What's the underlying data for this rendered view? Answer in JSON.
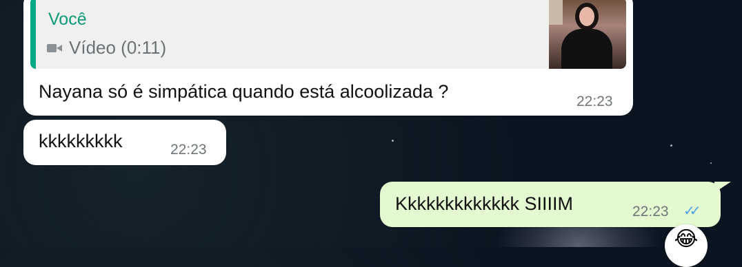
{
  "messages": [
    {
      "direction": "incoming",
      "reply_to": {
        "author": "Você",
        "media_label": "Vídeo (0:11)",
        "media_icon": "video-icon",
        "has_thumbnail": true
      },
      "text": "Nayana só é simpática quando está alcoolizada ?",
      "time": "22:23"
    },
    {
      "direction": "incoming",
      "text": "kkkkkkkkk",
      "time": "22:23"
    },
    {
      "direction": "outgoing",
      "text": "Kkkkkkkkkkkkk SIIIIM",
      "time": "22:23",
      "status": "read",
      "status_icon": "double-check-icon",
      "status_color": "#4aa3e8"
    }
  ],
  "reaction": {
    "icon": "tears-of-joy-emoji-icon",
    "glyph": "😂"
  },
  "colors": {
    "background": "#0b1521",
    "incoming_bubble": "#ffffff",
    "outgoing_bubble": "#e3f9cf",
    "quote_accent": "#06a884",
    "read_ticks": "#4aa3e8"
  }
}
